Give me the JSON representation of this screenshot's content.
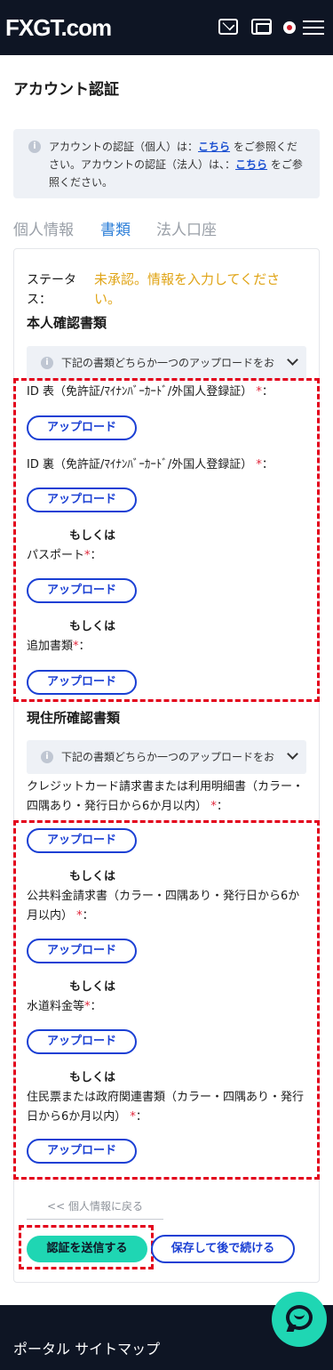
{
  "header": {
    "logo_text": "FXGT.com",
    "icons": [
      "mail-icon",
      "ticket-icon",
      "japan-flag-icon",
      "hamburger-menu-icon"
    ]
  },
  "page": {
    "title": "アカウント認証"
  },
  "info": {
    "text_1": "アカウントの認証（個人）は：",
    "link_1": "こちら",
    "text_2": "をご参照ください。アカウントの認証（法人）は、：",
    "link_2": "こちら",
    "text_3": "をご参照ください。"
  },
  "tabs": [
    {
      "label": "個人情報"
    },
    {
      "label": "書類"
    },
    {
      "label": "法人口座"
    }
  ],
  "status": {
    "label": "ステータス：",
    "value": "未承認。情報を入力してください。",
    "color": "#e0a416"
  },
  "identity": {
    "title": "本人確認書類",
    "select_text": "下記の書類どちらか一つのアップロードをお",
    "fields": [
      {
        "label": "ID 表（免許証/ﾏｲﾅﾝﾊﾞｰｶｰﾄﾞ/外国人登録証）"
      },
      {
        "label": "ID 裏（免許証/ﾏｲﾅﾝﾊﾞｰｶｰﾄﾞ/外国人登録証）"
      },
      {
        "label": "パスポート"
      },
      {
        "label": "追加書類"
      }
    ]
  },
  "address": {
    "title": "現住所確認書類",
    "select_text": "下記の書類どちらか一つのアップロードをお",
    "fields": [
      {
        "label": "クレジットカード請求書または利用明細書（カラー・四隅あり・発行日から6か月以内）"
      },
      {
        "label": "公共料金請求書（カラー・四隅あり・発行日から6か月以内）"
      },
      {
        "label": "水道料金等"
      },
      {
        "label": "住民票または政府関連書類（カラー・四隅あり・発行日から6か月以内）"
      }
    ]
  },
  "common": {
    "upload_label": "アップロード",
    "or_label": "もしくは",
    "required_mark": "*",
    "colon": "："
  },
  "actions": {
    "back": "<< 個人情報に戻る",
    "submit": "認証を送信する",
    "save": "保存して後で続ける"
  },
  "footer": {
    "title": "ポータル サイトマップ"
  },
  "colors": {
    "header_bg": "#0e1524",
    "accent_teal": "#1fd6b3",
    "accent_blue": "#1a3fd4",
    "active_tab": "#2d7fd8",
    "highlight_red": "#e3001b"
  }
}
